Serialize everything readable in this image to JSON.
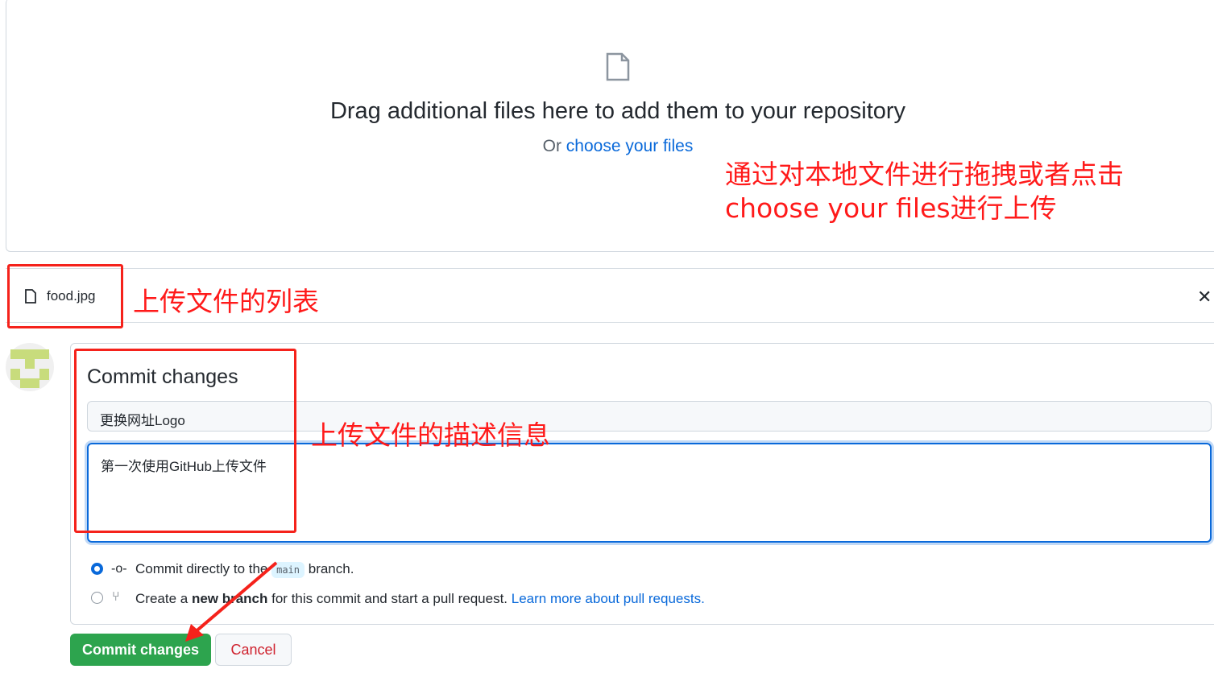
{
  "dropzone": {
    "title": "Drag additional files here to add them to your repository",
    "or": "Or ",
    "choose": "choose your files",
    "icon": "file-icon"
  },
  "annotations": {
    "drop": "通过对本地文件进行拖拽或者点击",
    "drop2": "choose your files进行上传",
    "list": "上传文件的列表",
    "desc": "上传文件的描述信息"
  },
  "files": [
    {
      "name": "food.jpg",
      "icon": "file-icon"
    }
  ],
  "commit": {
    "heading": "Commit changes",
    "summary": "更换网址Logo",
    "description": "第一次使用GitHub上传文件",
    "option1": {
      "pre": "Commit directly to the ",
      "branch": "main",
      "post": " branch.",
      "selected": true
    },
    "option2": {
      "pre": "Create a ",
      "bold": "new branch",
      "post": " for this commit and start a pull request. ",
      "link": "Learn more about pull requests.",
      "selected": false
    },
    "submit": "Commit changes",
    "cancel": "Cancel"
  },
  "colors": {
    "accent": "#0969da",
    "primary": "#2da44e",
    "annotation": "#ff1a1a"
  }
}
